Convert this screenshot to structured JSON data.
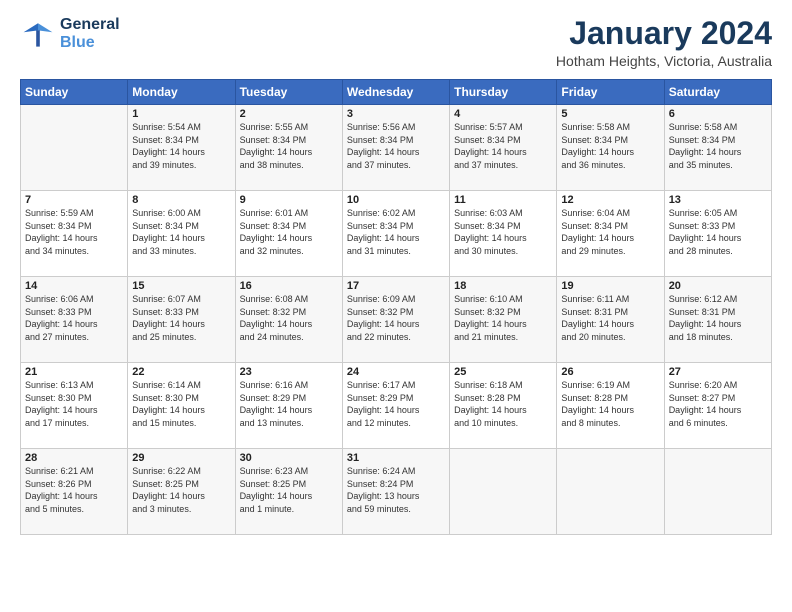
{
  "header": {
    "logo_line1": "General",
    "logo_line2": "Blue",
    "main_title": "January 2024",
    "subtitle": "Hotham Heights, Victoria, Australia"
  },
  "columns": [
    "Sunday",
    "Monday",
    "Tuesday",
    "Wednesday",
    "Thursday",
    "Friday",
    "Saturday"
  ],
  "weeks": [
    [
      {
        "day": "",
        "content": ""
      },
      {
        "day": "1",
        "content": "Sunrise: 5:54 AM\nSunset: 8:34 PM\nDaylight: 14 hours\nand 39 minutes."
      },
      {
        "day": "2",
        "content": "Sunrise: 5:55 AM\nSunset: 8:34 PM\nDaylight: 14 hours\nand 38 minutes."
      },
      {
        "day": "3",
        "content": "Sunrise: 5:56 AM\nSunset: 8:34 PM\nDaylight: 14 hours\nand 37 minutes."
      },
      {
        "day": "4",
        "content": "Sunrise: 5:57 AM\nSunset: 8:34 PM\nDaylight: 14 hours\nand 37 minutes."
      },
      {
        "day": "5",
        "content": "Sunrise: 5:58 AM\nSunset: 8:34 PM\nDaylight: 14 hours\nand 36 minutes."
      },
      {
        "day": "6",
        "content": "Sunrise: 5:58 AM\nSunset: 8:34 PM\nDaylight: 14 hours\nand 35 minutes."
      }
    ],
    [
      {
        "day": "7",
        "content": "Sunrise: 5:59 AM\nSunset: 8:34 PM\nDaylight: 14 hours\nand 34 minutes."
      },
      {
        "day": "8",
        "content": "Sunrise: 6:00 AM\nSunset: 8:34 PM\nDaylight: 14 hours\nand 33 minutes."
      },
      {
        "day": "9",
        "content": "Sunrise: 6:01 AM\nSunset: 8:34 PM\nDaylight: 14 hours\nand 32 minutes."
      },
      {
        "day": "10",
        "content": "Sunrise: 6:02 AM\nSunset: 8:34 PM\nDaylight: 14 hours\nand 31 minutes."
      },
      {
        "day": "11",
        "content": "Sunrise: 6:03 AM\nSunset: 8:34 PM\nDaylight: 14 hours\nand 30 minutes."
      },
      {
        "day": "12",
        "content": "Sunrise: 6:04 AM\nSunset: 8:34 PM\nDaylight: 14 hours\nand 29 minutes."
      },
      {
        "day": "13",
        "content": "Sunrise: 6:05 AM\nSunset: 8:33 PM\nDaylight: 14 hours\nand 28 minutes."
      }
    ],
    [
      {
        "day": "14",
        "content": "Sunrise: 6:06 AM\nSunset: 8:33 PM\nDaylight: 14 hours\nand 27 minutes."
      },
      {
        "day": "15",
        "content": "Sunrise: 6:07 AM\nSunset: 8:33 PM\nDaylight: 14 hours\nand 25 minutes."
      },
      {
        "day": "16",
        "content": "Sunrise: 6:08 AM\nSunset: 8:32 PM\nDaylight: 14 hours\nand 24 minutes."
      },
      {
        "day": "17",
        "content": "Sunrise: 6:09 AM\nSunset: 8:32 PM\nDaylight: 14 hours\nand 22 minutes."
      },
      {
        "day": "18",
        "content": "Sunrise: 6:10 AM\nSunset: 8:32 PM\nDaylight: 14 hours\nand 21 minutes."
      },
      {
        "day": "19",
        "content": "Sunrise: 6:11 AM\nSunset: 8:31 PM\nDaylight: 14 hours\nand 20 minutes."
      },
      {
        "day": "20",
        "content": "Sunrise: 6:12 AM\nSunset: 8:31 PM\nDaylight: 14 hours\nand 18 minutes."
      }
    ],
    [
      {
        "day": "21",
        "content": "Sunrise: 6:13 AM\nSunset: 8:30 PM\nDaylight: 14 hours\nand 17 minutes."
      },
      {
        "day": "22",
        "content": "Sunrise: 6:14 AM\nSunset: 8:30 PM\nDaylight: 14 hours\nand 15 minutes."
      },
      {
        "day": "23",
        "content": "Sunrise: 6:16 AM\nSunset: 8:29 PM\nDaylight: 14 hours\nand 13 minutes."
      },
      {
        "day": "24",
        "content": "Sunrise: 6:17 AM\nSunset: 8:29 PM\nDaylight: 14 hours\nand 12 minutes."
      },
      {
        "day": "25",
        "content": "Sunrise: 6:18 AM\nSunset: 8:28 PM\nDaylight: 14 hours\nand 10 minutes."
      },
      {
        "day": "26",
        "content": "Sunrise: 6:19 AM\nSunset: 8:28 PM\nDaylight: 14 hours\nand 8 minutes."
      },
      {
        "day": "27",
        "content": "Sunrise: 6:20 AM\nSunset: 8:27 PM\nDaylight: 14 hours\nand 6 minutes."
      }
    ],
    [
      {
        "day": "28",
        "content": "Sunrise: 6:21 AM\nSunset: 8:26 PM\nDaylight: 14 hours\nand 5 minutes."
      },
      {
        "day": "29",
        "content": "Sunrise: 6:22 AM\nSunset: 8:25 PM\nDaylight: 14 hours\nand 3 minutes."
      },
      {
        "day": "30",
        "content": "Sunrise: 6:23 AM\nSunset: 8:25 PM\nDaylight: 14 hours\nand 1 minute."
      },
      {
        "day": "31",
        "content": "Sunrise: 6:24 AM\nSunset: 8:24 PM\nDaylight: 13 hours\nand 59 minutes."
      },
      {
        "day": "",
        "content": ""
      },
      {
        "day": "",
        "content": ""
      },
      {
        "day": "",
        "content": ""
      }
    ]
  ]
}
